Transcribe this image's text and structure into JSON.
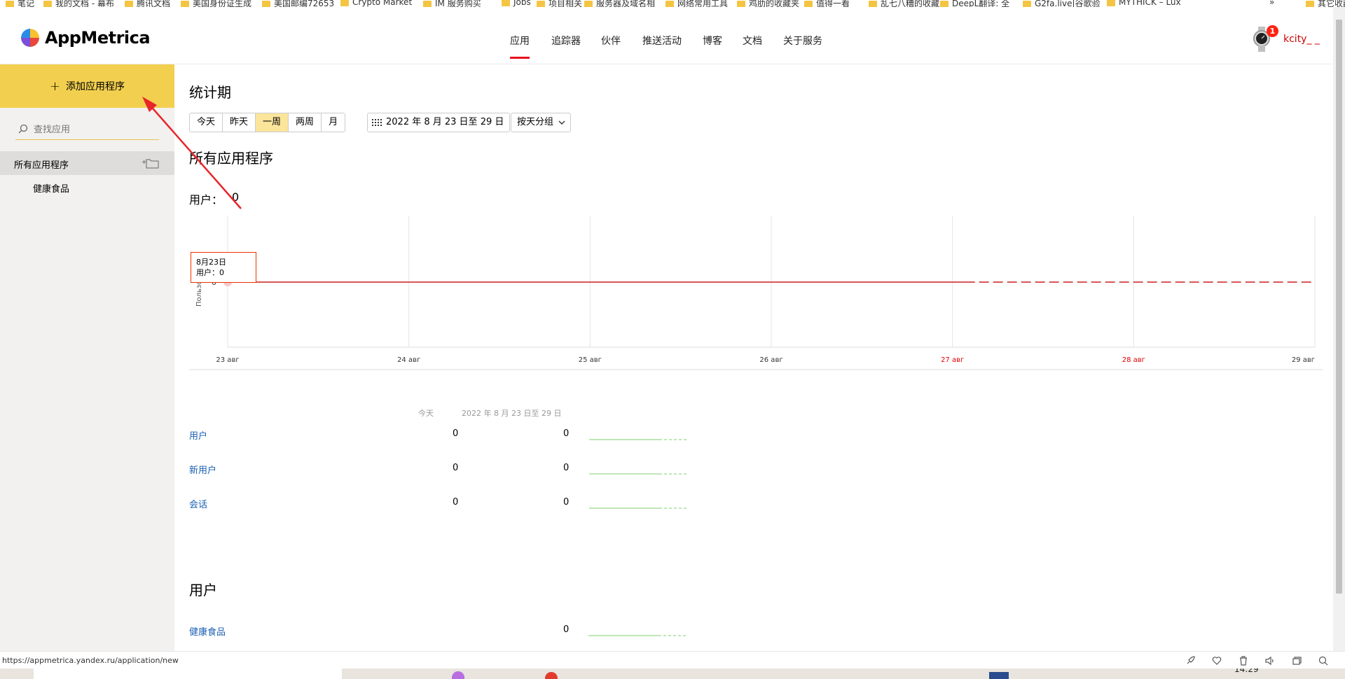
{
  "bookmarks": [
    "笔记",
    "我的文档 - 幕布",
    "腾讯文档",
    "美国身份证生成",
    "美国邮编72653",
    "Crypto Market",
    "IM 服务购买",
    "Jobs",
    "项目相关",
    "服务器及域名相",
    "网络常用工具",
    "鸡肋的收藏夹",
    "值得一看",
    "乱七八糟的收藏",
    "DeepL翻译: 全",
    "G2fa.live|谷歌验",
    "MYTHICK – Lux",
    "»",
    "其它收藏"
  ],
  "header": {
    "brand": "AppMetrica",
    "nav": [
      "应用",
      "追踪器",
      "伙伴",
      "推送活动",
      "博客",
      "文档",
      "关于服务"
    ],
    "notification_count": "1",
    "username": "kcity_ _"
  },
  "sidebar": {
    "add_app_label": "添加应用程序",
    "search_placeholder": "查找应用",
    "all_apps_label": "所有应用程序",
    "apps": [
      "健康食品"
    ]
  },
  "main": {
    "page_title": "统计期",
    "period_buttons": [
      "今天",
      "昨天",
      "一周",
      "两周",
      "月"
    ],
    "active_period": "一周",
    "date_range": "2022 年 8 月 23 日至 29 日",
    "group_by": "按天分组",
    "section_title": "所有应用程序",
    "users_label": "用户：",
    "users_value": "0",
    "tooltip": {
      "date": "8月23日",
      "line": "用户：0"
    },
    "summary_headers": {
      "today": "今天",
      "period": "2022 年 8 月 23 日至 29 日"
    },
    "metrics": [
      {
        "name": "用户",
        "today": "0",
        "period": "0"
      },
      {
        "name": "新用户",
        "today": "0",
        "period": "0"
      },
      {
        "name": "会话",
        "today": "0",
        "period": "0"
      }
    ],
    "users_section_title": "用户",
    "app_rows": [
      {
        "name": "健康食品",
        "value": "0"
      }
    ]
  },
  "chart_data": {
    "type": "line",
    "x": [
      "23 авг",
      "24 авг",
      "25 авг",
      "26 авг",
      "27 авг",
      "28 авг",
      "29 авг"
    ],
    "weekend_labels": [
      "27 авг",
      "28 авг"
    ],
    "series": [
      {
        "values": [
          0,
          0,
          0,
          0,
          0,
          0,
          0
        ]
      }
    ],
    "ylabel": "Пользова",
    "y_ticks": [
      "0"
    ],
    "dashed_from": "27 авг",
    "colors": {
      "line": "#c81e1e",
      "weekend_label": "#e00000",
      "grid": "#e5e5e5"
    }
  },
  "statusbar": {
    "url": "https://appmetrica.yandex.ru/application/new"
  },
  "taskbar": {
    "clock": "14:29"
  },
  "colors": {
    "accent_yellow": "#f2cf4f",
    "nav_active": "#e8101c",
    "link_blue": "#1a5fb4"
  }
}
